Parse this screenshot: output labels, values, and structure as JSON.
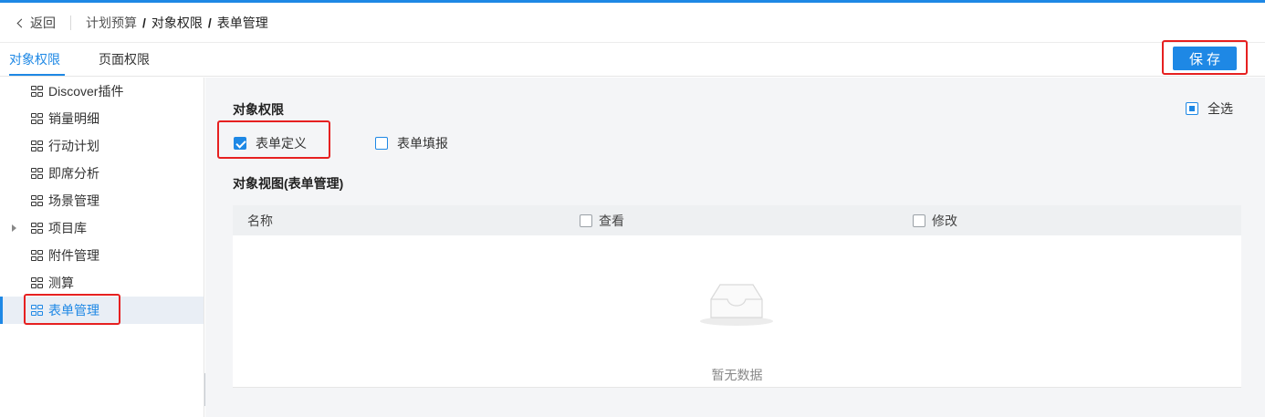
{
  "header": {
    "back_label": "返回",
    "breadcrumb_root": "计划预算",
    "breadcrumb_items": [
      "对象权限",
      "表单管理"
    ]
  },
  "tabs": [
    {
      "label": "对象权限",
      "active": true
    },
    {
      "label": "页面权限",
      "active": false
    }
  ],
  "toolbar": {
    "save_label": "保存"
  },
  "sidebar": {
    "items": [
      {
        "label": "Discover插件"
      },
      {
        "label": "销量明细"
      },
      {
        "label": "行动计划"
      },
      {
        "label": "即席分析"
      },
      {
        "label": "场景管理"
      },
      {
        "label": "项目库",
        "expandable": true
      },
      {
        "label": "附件管理"
      },
      {
        "label": "测算"
      },
      {
        "label": "表单管理",
        "selected": true
      }
    ]
  },
  "main": {
    "permissions_title": "对象权限",
    "select_all_label": "全选",
    "permissions": [
      {
        "label": "表单定义",
        "checked": true
      },
      {
        "label": "表单填报",
        "checked": false
      }
    ],
    "view_title": "对象视图(表单管理)",
    "table": {
      "columns": [
        "名称",
        "查看",
        "修改"
      ],
      "empty_text": "暂无数据"
    }
  },
  "colors": {
    "accent": "#1e88e5",
    "highlight": "#e62020"
  }
}
